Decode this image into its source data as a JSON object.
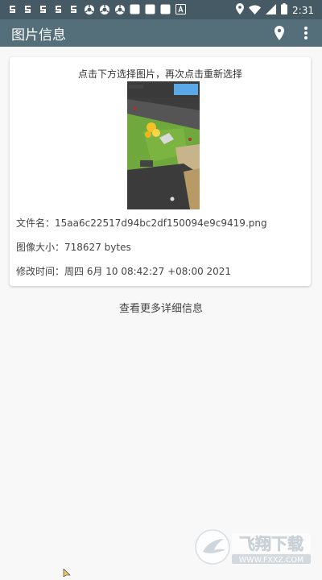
{
  "status_bar": {
    "time": "2:31",
    "notification_icons": [
      "app-icon",
      "app-icon",
      "app-icon",
      "app-icon",
      "app-icon",
      "vpn-icon",
      "vpn-icon",
      "vpn-icon",
      "square-icon",
      "square-icon",
      "square-icon",
      "a-icon"
    ],
    "system_icons": [
      "location-icon",
      "wifi-icon",
      "signal-icon",
      "battery-icon"
    ]
  },
  "app_bar": {
    "title": "图片信息",
    "actions": [
      "location-icon",
      "more-vert-icon"
    ],
    "color": "#546e7a"
  },
  "card": {
    "hint": "点击下方选择图片，再次点击重新选择",
    "file_name_label": "文件名：",
    "file_name": "15aa6c22517d94bc2df150094e9c9419.png",
    "size_label": "图像大小：",
    "size": "718627 bytes",
    "modified_label": "修改时间：",
    "modified": "周四 6月 10 08:42:27 +08:00 2021"
  },
  "more_details": "查看更多详细信息",
  "watermark": {
    "text": "飞翔下载",
    "url": "WWW.FXXZ.COM"
  }
}
